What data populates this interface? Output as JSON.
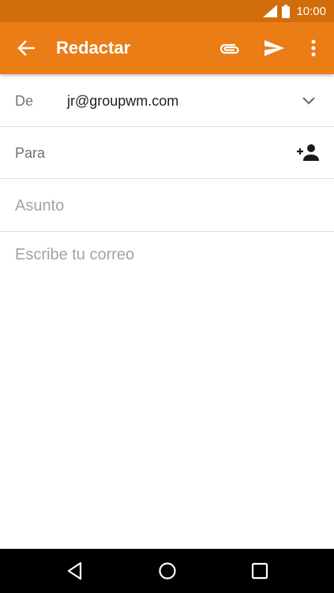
{
  "status_bar": {
    "time": "10:00",
    "icons": [
      "signal-icon",
      "battery-icon"
    ]
  },
  "app_bar": {
    "title": "Redactar",
    "color": "#ea7d16",
    "status_color": "#d26d0c",
    "icons": [
      "back-arrow-icon",
      "attach-icon",
      "send-icon",
      "more-vert-icon"
    ]
  },
  "compose": {
    "from_label": "De",
    "from_value": "jr@groupwm.com",
    "to_label": "Para",
    "subject_placeholder": "Asunto",
    "body_placeholder": "Escribe tu correo"
  },
  "nav_bar": {
    "icons": [
      "nav-back-icon",
      "nav-home-icon",
      "nav-recents-icon"
    ]
  }
}
